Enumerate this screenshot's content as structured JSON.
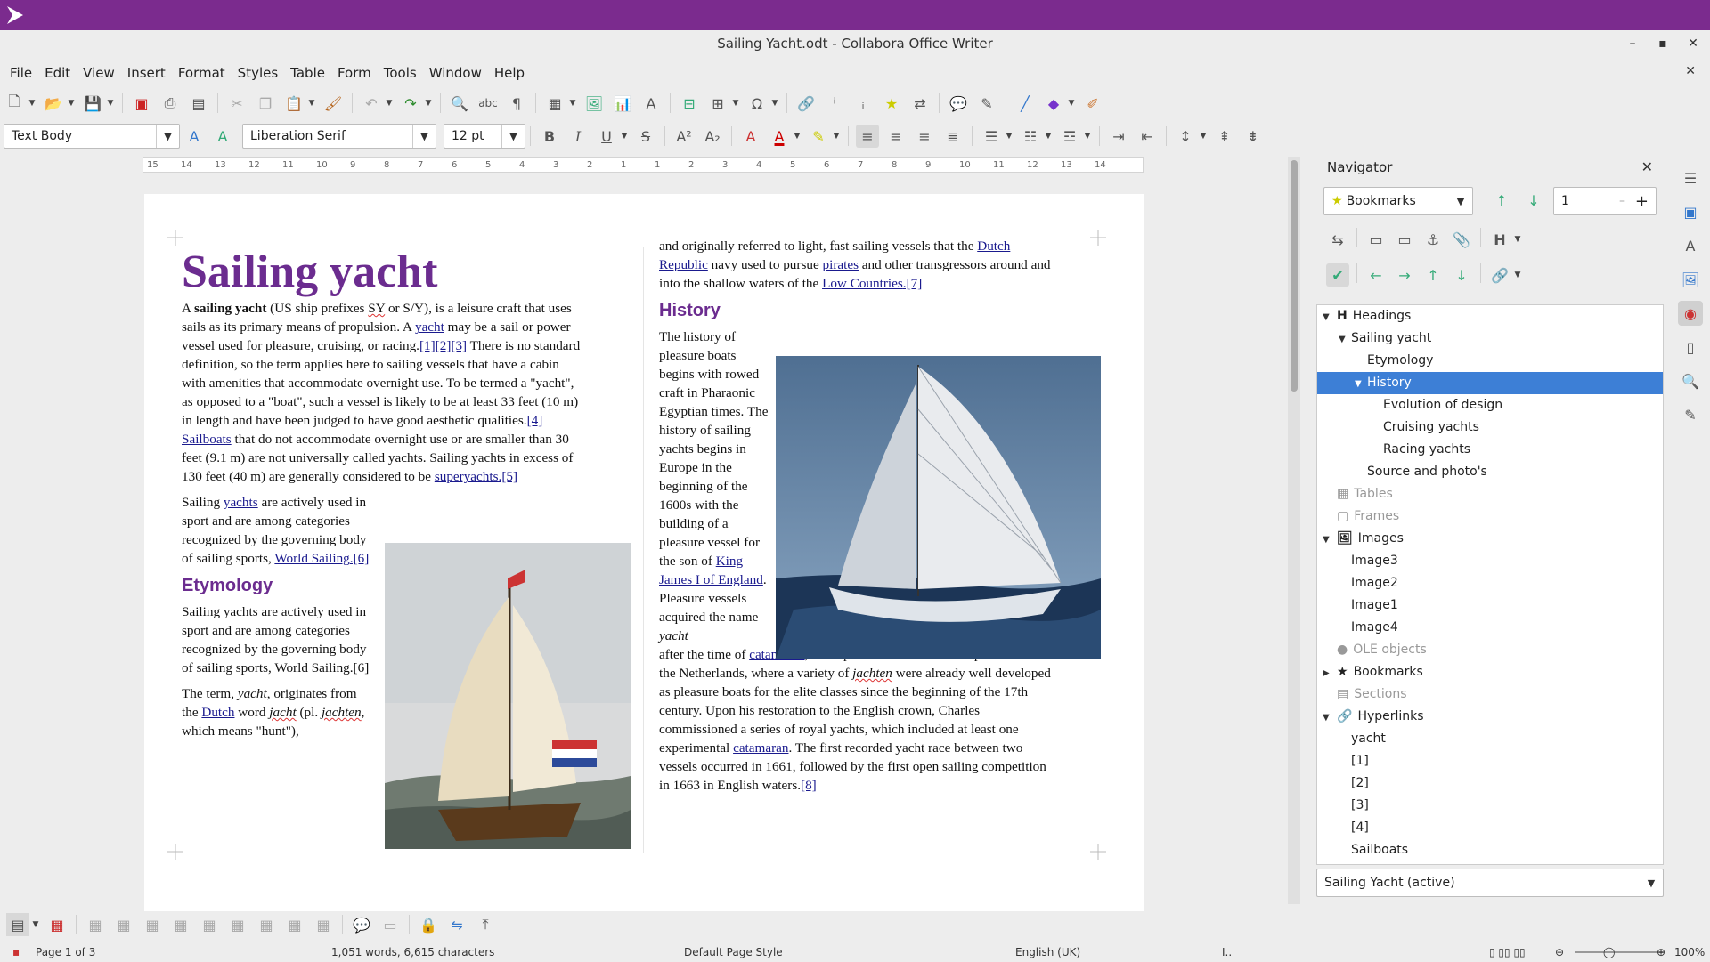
{
  "window": {
    "title": "Sailing Yacht.odt - Collabora Office Writer"
  },
  "menu": [
    "File",
    "Edit",
    "View",
    "Insert",
    "Format",
    "Styles",
    "Table",
    "Form",
    "Tools",
    "Window",
    "Help"
  ],
  "format": {
    "para_style": "Text Body",
    "font_name": "Liberation Serif",
    "font_size": "12 pt"
  },
  "ruler": [
    "15",
    "14",
    "13",
    "12",
    "11",
    "10",
    "9",
    "8",
    "7",
    "6",
    "5",
    "4",
    "3",
    "2",
    "1",
    "1",
    "2",
    "3",
    "4",
    "5",
    "6",
    "7",
    "8",
    "9",
    "10",
    "11",
    "12",
    "13",
    "14"
  ],
  "doc": {
    "title": "Sailing yacht",
    "p1": {
      "t1": "A ",
      "b1": "sailing yacht",
      "t2": " (US ship prefixes ",
      "sy": "SY",
      "t3": " or S/Y), is a leisure craft that uses sails as its primary means of propulsion. A ",
      "l1": "yacht",
      "t4": " may be a sail or power vessel used for pleasure, cruising, or racing.",
      "l2": "[1][2][3]",
      "t5": " There is no standard definition, so the term applies here to sailing vessels that have a cabin with amenities that accommodate overnight use. To be termed a \"yacht\", as opposed to a \"boat\", such a vessel is likely to be at least 33 feet (10 m) in length and have been judged to have good aesthetic qualities.",
      "l3": "[4]",
      "t6": " ",
      "l4": "Sailboats",
      "t7": " that do not accommodate overnight use or are smaller than 30 feet (9.1 m) are not universally called yachts. Sailing yachts in excess of 130 feet (40 m) are generally considered to be ",
      "l5": "superyachts",
      "l6": ".[5]"
    },
    "p2": {
      "t1": "Sailing ",
      "l1": "yachts",
      "t2": " are actively used in sport and are among categories recognized by the governing body of sailing sports, ",
      "l2": "World Sailing",
      "l3": ".[6]"
    },
    "h_etym": "Etymology",
    "p3": "Sailing yachts are actively used in sport and are among categories recognized by the governing body of sailing sports, World Sailing.[6]",
    "p4": {
      "t1": "The term, ",
      "i1": "yacht",
      "t2": ", originates from the ",
      "l1": "Dutch",
      "t3": " word ",
      "i2": "jacht",
      "t4": " (pl. ",
      "i3": "jachten",
      "t5": ", which means \"hunt\"),"
    },
    "c2p1": {
      "t1": "and originally referred to light, fast sailing vessels that the ",
      "l1": "Dutch Republic",
      "t2": " navy used to pursue ",
      "l2": "pirates",
      "t3": " and other transgressors around and into the shallow waters of the ",
      "l3": "Low Countries",
      "l4": ".[7]"
    },
    "h_hist": "History",
    "c2p2": {
      "t1": "The history of pleasure boats begins with rowed craft in Pharaonic Egyptian times. The history of sailing yachts begins in Europe in the beginning of the 1600s with the building of a pleasure vessel for the son of ",
      "l1": "King James I of England",
      "t2": ". Pleasure vessels acquired the name ",
      "i1": "yacht"
    },
    "c2p3": {
      "t1": "after the time of ",
      "l1": "catamaran",
      "t2": ", who spent time exiled in Europe and visited the Netherlands, where a variety of ",
      "i1": "jachten",
      "t3": " were already well developed as pleasure boats for the elite classes since the beginning of the 17th century. Upon his restoration to the English crown, Charles commissioned a series of royal yachts, which included at least one experimental ",
      "t4": ". The first recorded yacht race between two vessels occurred in 1661, followed by the first open sailing competition in 1663 in English waters.",
      "l2": "[8]"
    }
  },
  "navigator": {
    "title": "Navigator",
    "category": "Bookmarks",
    "page_num": "1",
    "items": [
      {
        "label": "Headings",
        "level": 0,
        "tog": "open",
        "icon": "H"
      },
      {
        "label": "Sailing yacht",
        "level": 1,
        "tog": "open"
      },
      {
        "label": "Etymology",
        "level": 2
      },
      {
        "label": "History",
        "level": 2,
        "tog": "open",
        "sel": true
      },
      {
        "label": "Evolution of design",
        "level": 3
      },
      {
        "label": "Cruising yachts",
        "level": 3
      },
      {
        "label": "Racing yachts",
        "level": 3
      },
      {
        "label": "Source and photo's",
        "level": 2
      },
      {
        "label": "Tables",
        "level": 0,
        "dim": true,
        "icon": "tbl"
      },
      {
        "label": "Frames",
        "level": 0,
        "dim": true,
        "icon": "frm"
      },
      {
        "label": "Images",
        "level": 0,
        "tog": "open",
        "icon": "img"
      },
      {
        "label": "Image3",
        "level": 1
      },
      {
        "label": "Image2",
        "level": 1
      },
      {
        "label": "Image1",
        "level": 1
      },
      {
        "label": "Image4",
        "level": 1
      },
      {
        "label": "OLE objects",
        "level": 0,
        "dim": true,
        "icon": "ole"
      },
      {
        "label": "Bookmarks",
        "level": 0,
        "tog": "closed",
        "icon": "bmk"
      },
      {
        "label": "Sections",
        "level": 0,
        "dim": true,
        "icon": "sec"
      },
      {
        "label": "Hyperlinks",
        "level": 0,
        "tog": "open",
        "icon": "lnk"
      },
      {
        "label": "yacht",
        "level": 1
      },
      {
        "label": "[1]",
        "level": 1
      },
      {
        "label": "[2]",
        "level": 1
      },
      {
        "label": "[3]",
        "level": 1
      },
      {
        "label": "[4]",
        "level": 1
      },
      {
        "label": "Sailboats",
        "level": 1
      }
    ],
    "doc_select": "Sailing Yacht (active)"
  },
  "status": {
    "page": "Page 1 of 3",
    "words": "1,051 words, 6,615 characters",
    "page_style": "Default Page Style",
    "lang": "English (UK)",
    "zoom": "100%"
  },
  "colors": {
    "accent": "#7b2b8e",
    "heading": "#6b2c8f",
    "selection": "#3d7fd6"
  }
}
